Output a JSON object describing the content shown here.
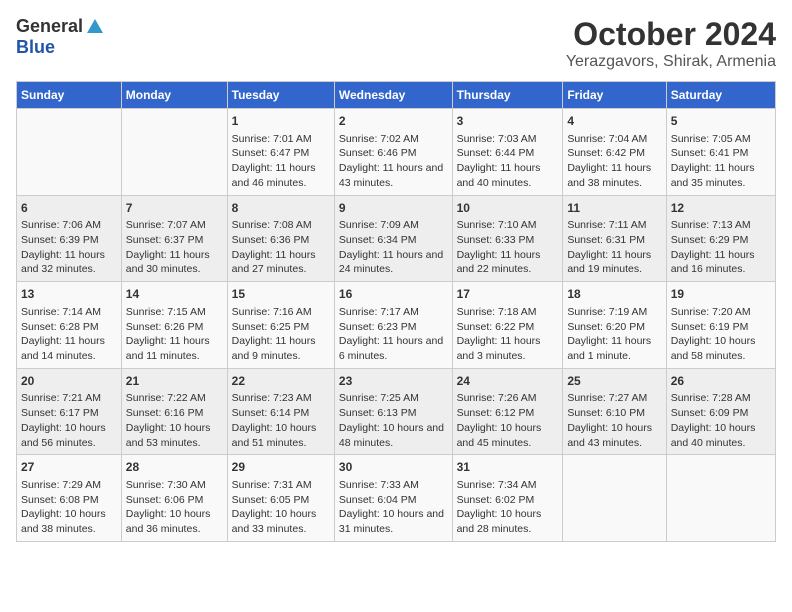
{
  "logo": {
    "general": "General",
    "blue": "Blue"
  },
  "header": {
    "month": "October 2024",
    "location": "Yerazgavors, Shirak, Armenia"
  },
  "columns": [
    "Sunday",
    "Monday",
    "Tuesday",
    "Wednesday",
    "Thursday",
    "Friday",
    "Saturday"
  ],
  "weeks": [
    [
      {
        "day": "",
        "info": ""
      },
      {
        "day": "",
        "info": ""
      },
      {
        "day": "1",
        "info": "Sunrise: 7:01 AM\nSunset: 6:47 PM\nDaylight: 11 hours and 46 minutes."
      },
      {
        "day": "2",
        "info": "Sunrise: 7:02 AM\nSunset: 6:46 PM\nDaylight: 11 hours and 43 minutes."
      },
      {
        "day": "3",
        "info": "Sunrise: 7:03 AM\nSunset: 6:44 PM\nDaylight: 11 hours and 40 minutes."
      },
      {
        "day": "4",
        "info": "Sunrise: 7:04 AM\nSunset: 6:42 PM\nDaylight: 11 hours and 38 minutes."
      },
      {
        "day": "5",
        "info": "Sunrise: 7:05 AM\nSunset: 6:41 PM\nDaylight: 11 hours and 35 minutes."
      }
    ],
    [
      {
        "day": "6",
        "info": "Sunrise: 7:06 AM\nSunset: 6:39 PM\nDaylight: 11 hours and 32 minutes."
      },
      {
        "day": "7",
        "info": "Sunrise: 7:07 AM\nSunset: 6:37 PM\nDaylight: 11 hours and 30 minutes."
      },
      {
        "day": "8",
        "info": "Sunrise: 7:08 AM\nSunset: 6:36 PM\nDaylight: 11 hours and 27 minutes."
      },
      {
        "day": "9",
        "info": "Sunrise: 7:09 AM\nSunset: 6:34 PM\nDaylight: 11 hours and 24 minutes."
      },
      {
        "day": "10",
        "info": "Sunrise: 7:10 AM\nSunset: 6:33 PM\nDaylight: 11 hours and 22 minutes."
      },
      {
        "day": "11",
        "info": "Sunrise: 7:11 AM\nSunset: 6:31 PM\nDaylight: 11 hours and 19 minutes."
      },
      {
        "day": "12",
        "info": "Sunrise: 7:13 AM\nSunset: 6:29 PM\nDaylight: 11 hours and 16 minutes."
      }
    ],
    [
      {
        "day": "13",
        "info": "Sunrise: 7:14 AM\nSunset: 6:28 PM\nDaylight: 11 hours and 14 minutes."
      },
      {
        "day": "14",
        "info": "Sunrise: 7:15 AM\nSunset: 6:26 PM\nDaylight: 11 hours and 11 minutes."
      },
      {
        "day": "15",
        "info": "Sunrise: 7:16 AM\nSunset: 6:25 PM\nDaylight: 11 hours and 9 minutes."
      },
      {
        "day": "16",
        "info": "Sunrise: 7:17 AM\nSunset: 6:23 PM\nDaylight: 11 hours and 6 minutes."
      },
      {
        "day": "17",
        "info": "Sunrise: 7:18 AM\nSunset: 6:22 PM\nDaylight: 11 hours and 3 minutes."
      },
      {
        "day": "18",
        "info": "Sunrise: 7:19 AM\nSunset: 6:20 PM\nDaylight: 11 hours and 1 minute."
      },
      {
        "day": "19",
        "info": "Sunrise: 7:20 AM\nSunset: 6:19 PM\nDaylight: 10 hours and 58 minutes."
      }
    ],
    [
      {
        "day": "20",
        "info": "Sunrise: 7:21 AM\nSunset: 6:17 PM\nDaylight: 10 hours and 56 minutes."
      },
      {
        "day": "21",
        "info": "Sunrise: 7:22 AM\nSunset: 6:16 PM\nDaylight: 10 hours and 53 minutes."
      },
      {
        "day": "22",
        "info": "Sunrise: 7:23 AM\nSunset: 6:14 PM\nDaylight: 10 hours and 51 minutes."
      },
      {
        "day": "23",
        "info": "Sunrise: 7:25 AM\nSunset: 6:13 PM\nDaylight: 10 hours and 48 minutes."
      },
      {
        "day": "24",
        "info": "Sunrise: 7:26 AM\nSunset: 6:12 PM\nDaylight: 10 hours and 45 minutes."
      },
      {
        "day": "25",
        "info": "Sunrise: 7:27 AM\nSunset: 6:10 PM\nDaylight: 10 hours and 43 minutes."
      },
      {
        "day": "26",
        "info": "Sunrise: 7:28 AM\nSunset: 6:09 PM\nDaylight: 10 hours and 40 minutes."
      }
    ],
    [
      {
        "day": "27",
        "info": "Sunrise: 7:29 AM\nSunset: 6:08 PM\nDaylight: 10 hours and 38 minutes."
      },
      {
        "day": "28",
        "info": "Sunrise: 7:30 AM\nSunset: 6:06 PM\nDaylight: 10 hours and 36 minutes."
      },
      {
        "day": "29",
        "info": "Sunrise: 7:31 AM\nSunset: 6:05 PM\nDaylight: 10 hours and 33 minutes."
      },
      {
        "day": "30",
        "info": "Sunrise: 7:33 AM\nSunset: 6:04 PM\nDaylight: 10 hours and 31 minutes."
      },
      {
        "day": "31",
        "info": "Sunrise: 7:34 AM\nSunset: 6:02 PM\nDaylight: 10 hours and 28 minutes."
      },
      {
        "day": "",
        "info": ""
      },
      {
        "day": "",
        "info": ""
      }
    ]
  ]
}
